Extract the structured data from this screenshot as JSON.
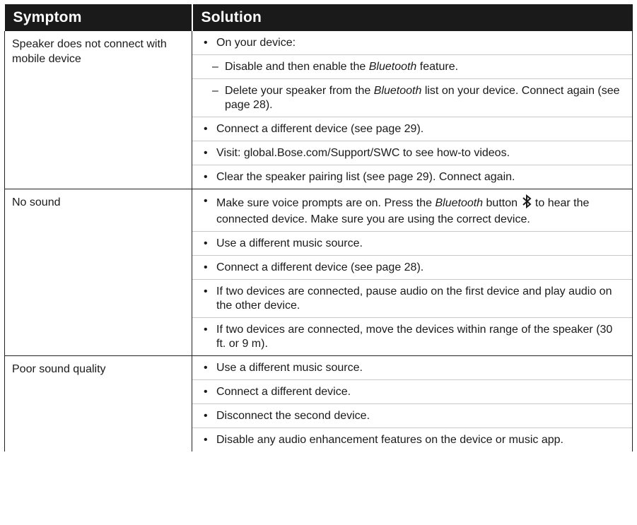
{
  "header": {
    "symptom": "Symptom",
    "solution": "Solution"
  },
  "rows": [
    {
      "symptom": "Speaker does not connect with mobile device",
      "items": [
        {
          "marker": "•",
          "parts": [
            "On your device:"
          ]
        },
        {
          "marker": "–",
          "sub": true,
          "parts": [
            "Disable and then enable the ",
            "Bluetooth",
            " feature."
          ]
        },
        {
          "marker": "–",
          "sub": true,
          "parts": [
            "Delete your speaker from the ",
            "Bluetooth",
            " list on your device. Connect again (see page 28)."
          ]
        },
        {
          "marker": "•",
          "parts": [
            "Connect a different device (see page 29)."
          ]
        },
        {
          "marker": "•",
          "parts": [
            "Visit: global.Bose.com/Support/SWC to see how-to videos."
          ]
        },
        {
          "marker": "•",
          "parts": [
            "Clear the speaker pairing list (see page 29). Connect again."
          ]
        }
      ]
    },
    {
      "symptom": "No sound",
      "items": [
        {
          "marker": "•",
          "parts": [
            "Make sure voice prompts are on. Press the ",
            "Bluetooth",
            " button ",
            "",
            " to hear the connected device. Make sure you are using the correct device."
          ],
          "icon": "bluetooth-icon"
        },
        {
          "marker": "•",
          "parts": [
            "Use a different music source."
          ]
        },
        {
          "marker": "•",
          "parts": [
            "Connect a different device (see page 28)."
          ]
        },
        {
          "marker": "•",
          "parts": [
            "If two devices are connected, pause audio on the first device and play audio on the other device."
          ]
        },
        {
          "marker": "•",
          "parts": [
            "If two devices are connected, move the devices within range of the speaker (30 ft. or 9 m)."
          ]
        }
      ]
    },
    {
      "symptom": "Poor sound quality",
      "items": [
        {
          "marker": "•",
          "parts": [
            "Use a different music source."
          ]
        },
        {
          "marker": "•",
          "parts": [
            "Connect a different device."
          ]
        },
        {
          "marker": "•",
          "parts": [
            "Disconnect the second device."
          ]
        },
        {
          "marker": "•",
          "parts": [
            "Disable any audio enhancement features on the device or music app."
          ]
        }
      ]
    }
  ]
}
